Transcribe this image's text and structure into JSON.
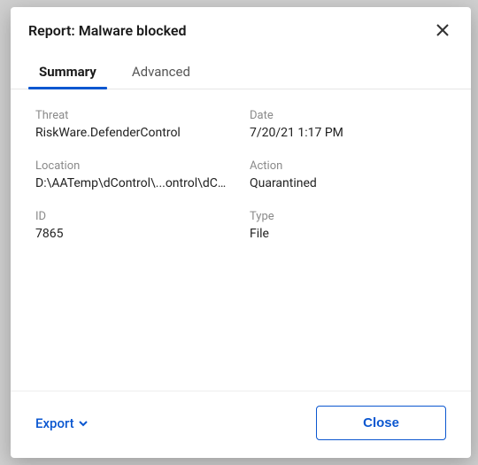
{
  "modal": {
    "title": "Report: Malware blocked"
  },
  "tabs": {
    "summary": "Summary",
    "advanced": "Advanced"
  },
  "fields": {
    "threat": {
      "label": "Threat",
      "value": "RiskWare.DefenderControl"
    },
    "date": {
      "label": "Date",
      "value": "7/20/21 1:17 PM"
    },
    "location": {
      "label": "Location",
      "value": "D:\\AATemp\\dControl\\...ontrol\\dControl.exe"
    },
    "action": {
      "label": "Action",
      "value": "Quarantined"
    },
    "id": {
      "label": "ID",
      "value": "7865"
    },
    "type": {
      "label": "Type",
      "value": "File"
    }
  },
  "footer": {
    "export": "Export",
    "close": "Close"
  }
}
